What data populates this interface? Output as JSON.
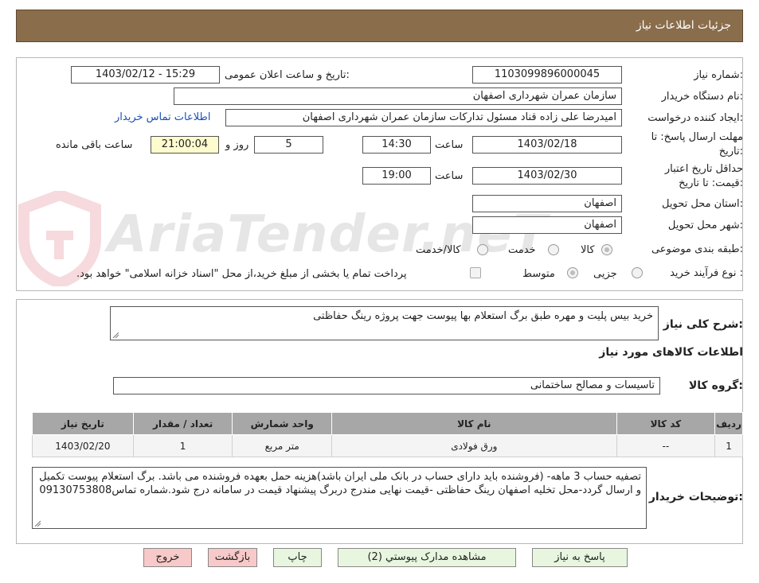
{
  "header": {
    "title": "جزئیات اطلاعات نیاز"
  },
  "form": {
    "need_number_label": "شماره نیاز:",
    "need_number": "1103099896000045",
    "announce_label": "تاریخ و ساعت اعلان عمومی:",
    "announce_value": "1403/02/12 - 15:29",
    "buyer_org_label": "نام دستگاه خریدار:",
    "buyer_org": "سازمان عمران شهرداری اصفهان",
    "creator_label": "ایجاد کننده درخواست:",
    "creator": "امیدرضا علی زاده قناد مسئول تدارکات سازمان عمران شهرداری اصفهان",
    "contact_link": "اطلاعات تماس خریدار",
    "deadline_label_1": "مهلت ارسال پاسخ: تا",
    "deadline_label_2": "تاریخ:",
    "deadline_date": "1403/02/18",
    "time_label": "ساعت",
    "deadline_time": "14:30",
    "days_value": "5",
    "days_label": "روز و",
    "remaining_time": "21:00:04",
    "remaining_label": "ساعت باقی مانده",
    "validity_label_1": "حداقل تاریخ اعتبار",
    "validity_label_2": "قیمت: تا تاریخ:",
    "validity_date": "1403/02/30",
    "validity_time_label": "ساعت",
    "validity_time": "19:00",
    "province_label": "استان محل تحویل:",
    "province": "اصفهان",
    "city_label": "شهر محل تحویل:",
    "city": "اصفهان",
    "category_label": "طبقه بندی موضوعی:",
    "category_options": [
      "کالا",
      "خدمت",
      "کالا/خدمت"
    ],
    "process_label": "نوع فرآیند خرید :",
    "process_options": [
      "جزیی",
      "متوسط"
    ],
    "payment_note": "پرداخت تمام یا بخشی از مبلغ خرید،از محل \"اسناد خزانه اسلامی\" خواهد بود."
  },
  "watermark": {
    "text": "AriaTender.neT"
  },
  "summary": {
    "label": "شرح کلی نیاز:",
    "text": "خرید بیس پلیت و مهره طبق برگ استعلام بها پیوست جهت پروژه رینگ حفاظتی"
  },
  "goods_info": {
    "title": "اطلاعات کالاهای مورد نیاز"
  },
  "goods_group": {
    "label": "گروه کالا:",
    "value": "تاسیسات و مصالح ساختمانی"
  },
  "table": {
    "headers": [
      "ردیف",
      "کد کالا",
      "نام کالا",
      "واحد شمارش",
      "تعداد / مقدار",
      "تاریخ نیاز"
    ],
    "rows": [
      [
        "1",
        "--",
        "ورق فولادی",
        "متر مربع",
        "1",
        "1403/02/20"
      ]
    ]
  },
  "buyer_notes": {
    "label": "توضیحات خریدار:",
    "text": "تصفیه حساب 3 ماهه- (فروشنده باید دارای حساب در بانک ملی ایران باشد)هزینه حمل بعهده فروشنده می باشد. برگ استعلام پیوست تکمیل و ارسال گردد-محل تخلیه اصفهان رینگ حفاظتی -قیمت نهایی مندرج دربرگ پیشنهاد قیمت در سامانه درج شود.شماره تماس09130753808"
  },
  "buttons": {
    "reply": "پاسخ به نیاز",
    "attachments": "مشاهده مدارک پیوستي (2)",
    "print": "چاپ",
    "back": "بازگشت",
    "exit": "خروج"
  }
}
